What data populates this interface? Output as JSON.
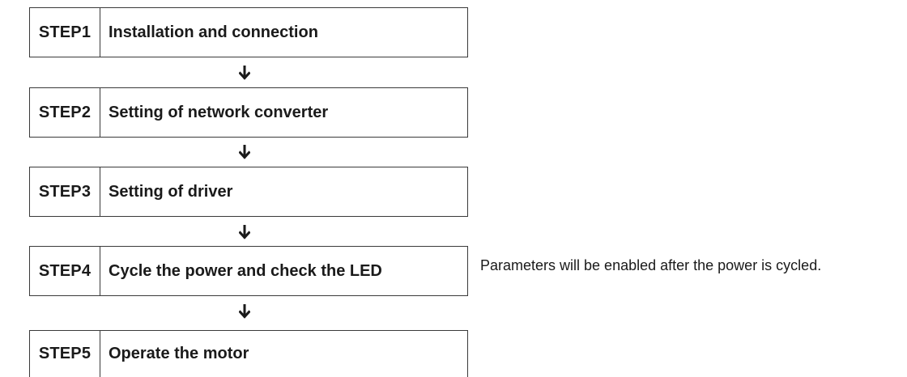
{
  "steps": [
    {
      "id": "STEP1",
      "title": "Installation and connection"
    },
    {
      "id": "STEP2",
      "title": "Setting of network converter"
    },
    {
      "id": "STEP3",
      "title": "Setting of driver"
    },
    {
      "id": "STEP4",
      "title": "Cycle the power and check the LED"
    },
    {
      "id": "STEP5",
      "title": "Operate the motor"
    }
  ],
  "note": "Parameters will be enabled after the power is cycled.",
  "arrow_icon": "arrow-down-icon"
}
